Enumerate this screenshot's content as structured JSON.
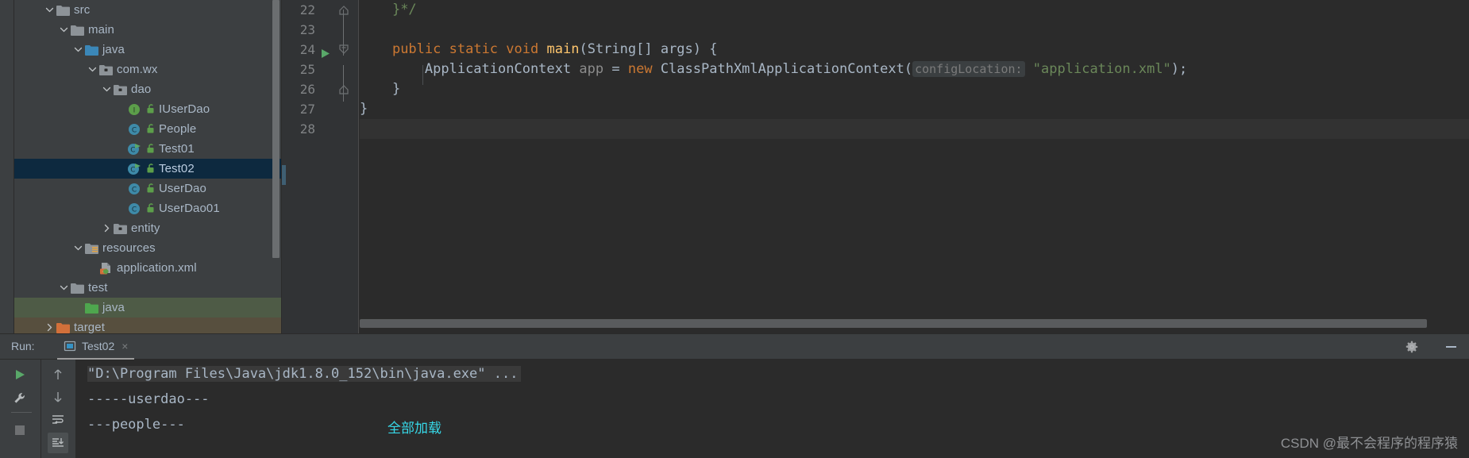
{
  "project_tree": {
    "panel_name": "project-tool-window",
    "rows": [
      {
        "depth": 2,
        "arrow": "chevron-down",
        "icon": "folder-plain",
        "label": "src",
        "lock": false,
        "state": "normal"
      },
      {
        "depth": 3,
        "arrow": "chevron-down",
        "icon": "folder-plain",
        "label": "main",
        "lock": false,
        "state": "normal"
      },
      {
        "depth": 4,
        "arrow": "chevron-down",
        "icon": "folder-sources",
        "label": "java",
        "lock": false,
        "state": "normal"
      },
      {
        "depth": 5,
        "arrow": "chevron-down",
        "icon": "package",
        "label": "com.wx",
        "lock": false,
        "state": "normal"
      },
      {
        "depth": 6,
        "arrow": "chevron-down",
        "icon": "package",
        "label": "dao",
        "lock": false,
        "state": "normal"
      },
      {
        "depth": 7,
        "arrow": "none",
        "icon": "interface",
        "label": "IUserDao",
        "lock": true,
        "state": "normal"
      },
      {
        "depth": 7,
        "arrow": "none",
        "icon": "class",
        "label": "People",
        "lock": true,
        "state": "normal"
      },
      {
        "depth": 7,
        "arrow": "none",
        "icon": "class-runnable",
        "label": "Test01",
        "lock": true,
        "state": "normal"
      },
      {
        "depth": 7,
        "arrow": "none",
        "icon": "class-runnable",
        "label": "Test02",
        "lock": true,
        "state": "selected"
      },
      {
        "depth": 7,
        "arrow": "none",
        "icon": "class",
        "label": "UserDao",
        "lock": true,
        "state": "normal"
      },
      {
        "depth": 7,
        "arrow": "none",
        "icon": "class",
        "label": "UserDao01",
        "lock": true,
        "state": "normal"
      },
      {
        "depth": 6,
        "arrow": "chevron-right",
        "icon": "package",
        "label": "entity",
        "lock": false,
        "state": "normal"
      },
      {
        "depth": 4,
        "arrow": "chevron-down",
        "icon": "folder-resources",
        "label": "resources",
        "lock": false,
        "state": "normal"
      },
      {
        "depth": 5,
        "arrow": "none",
        "icon": "spring-xml",
        "label": "application.xml",
        "lock": false,
        "state": "normal"
      },
      {
        "depth": 3,
        "arrow": "chevron-down",
        "icon": "folder-plain",
        "label": "test",
        "lock": false,
        "state": "normal"
      },
      {
        "depth": 4,
        "arrow": "none",
        "icon": "folder-test",
        "label": "java",
        "lock": false,
        "state": "green-highlight"
      },
      {
        "depth": 2,
        "arrow": "chevron-right",
        "icon": "folder-target",
        "label": "target",
        "lock": false,
        "state": "brown-highlight"
      }
    ]
  },
  "editor": {
    "first_visible_line": 22,
    "caret_line": 28,
    "lines": [
      {
        "num": 22,
        "fold": "fold-end",
        "run_marker": false,
        "text": "    }*/"
      },
      {
        "num": 23,
        "fold": "none",
        "run_marker": false,
        "text": ""
      },
      {
        "num": 24,
        "fold": "fold-start",
        "run_marker": true,
        "text": "    public static void main(String[] args) {"
      },
      {
        "num": 25,
        "fold": "none",
        "run_marker": false,
        "text": "        ApplicationContext app = new ClassPathXmlApplicationContext( configLocation: \"application.xml\");"
      },
      {
        "num": 26,
        "fold": "fold-end",
        "run_marker": false,
        "text": "    }"
      },
      {
        "num": 27,
        "fold": "none",
        "run_marker": false,
        "text": "}"
      },
      {
        "num": 28,
        "fold": "none",
        "run_marker": false,
        "text": ""
      }
    ],
    "tokens": {
      "line22": "}*/",
      "line24": {
        "kw1": "public",
        "kw2": "static",
        "kw3": "void",
        "method": "main",
        "open": "(",
        "type": "String[]",
        "space": " ",
        "arg": "args",
        "close": ") {"
      },
      "line25": {
        "type": "ApplicationContext",
        "var": "app",
        "eq": "=",
        "kw": "new",
        "ctor": "ClassPathXmlApplicationContext(",
        "hint": "configLocation:",
        "str": "\"application.xml\"",
        "tail": ");"
      },
      "line26": "}",
      "line27": "}"
    },
    "colors": {
      "keyword": "#cc7832",
      "method": "#ffc66d",
      "string": "#6a8759",
      "default_text": "#a9b7c6",
      "background": "#2b2b2b",
      "gutter": "#313335"
    }
  },
  "run_window": {
    "label": "Run:",
    "tab": {
      "title": "Test02",
      "icon": "run-config-icon",
      "close": "×"
    },
    "gear_icon": "gear-icon",
    "minimize_icon": "minimize-icon",
    "toolbar_left": [
      {
        "name": "rerun-button",
        "icon": "play-triangle"
      },
      {
        "name": "settings-button",
        "icon": "wrench"
      },
      {
        "name": "stop-button",
        "icon": "stop-square"
      }
    ],
    "toolbar_right": [
      {
        "name": "prev-occurrence-button",
        "icon": "arrow-up"
      },
      {
        "name": "next-occurrence-button",
        "icon": "arrow-down"
      },
      {
        "name": "soft-wrap-button",
        "icon": "soft-wrap"
      },
      {
        "name": "scroll-to-end-button",
        "icon": "scroll-to-end"
      }
    ],
    "console_lines": [
      {
        "text": "\"D:\\Program Files\\Java\\jdk1.8.0_152\\bin\\java.exe\" ...",
        "style": "highlighted"
      },
      {
        "text": "-----userdao---",
        "style": "plain"
      },
      {
        "text": "---people---",
        "style": "plain"
      }
    ],
    "console_annotation": {
      "text": "全部加载",
      "color": "#37d8e8"
    }
  },
  "watermark": {
    "text": "CSDN @最不会程序的程序猿"
  }
}
